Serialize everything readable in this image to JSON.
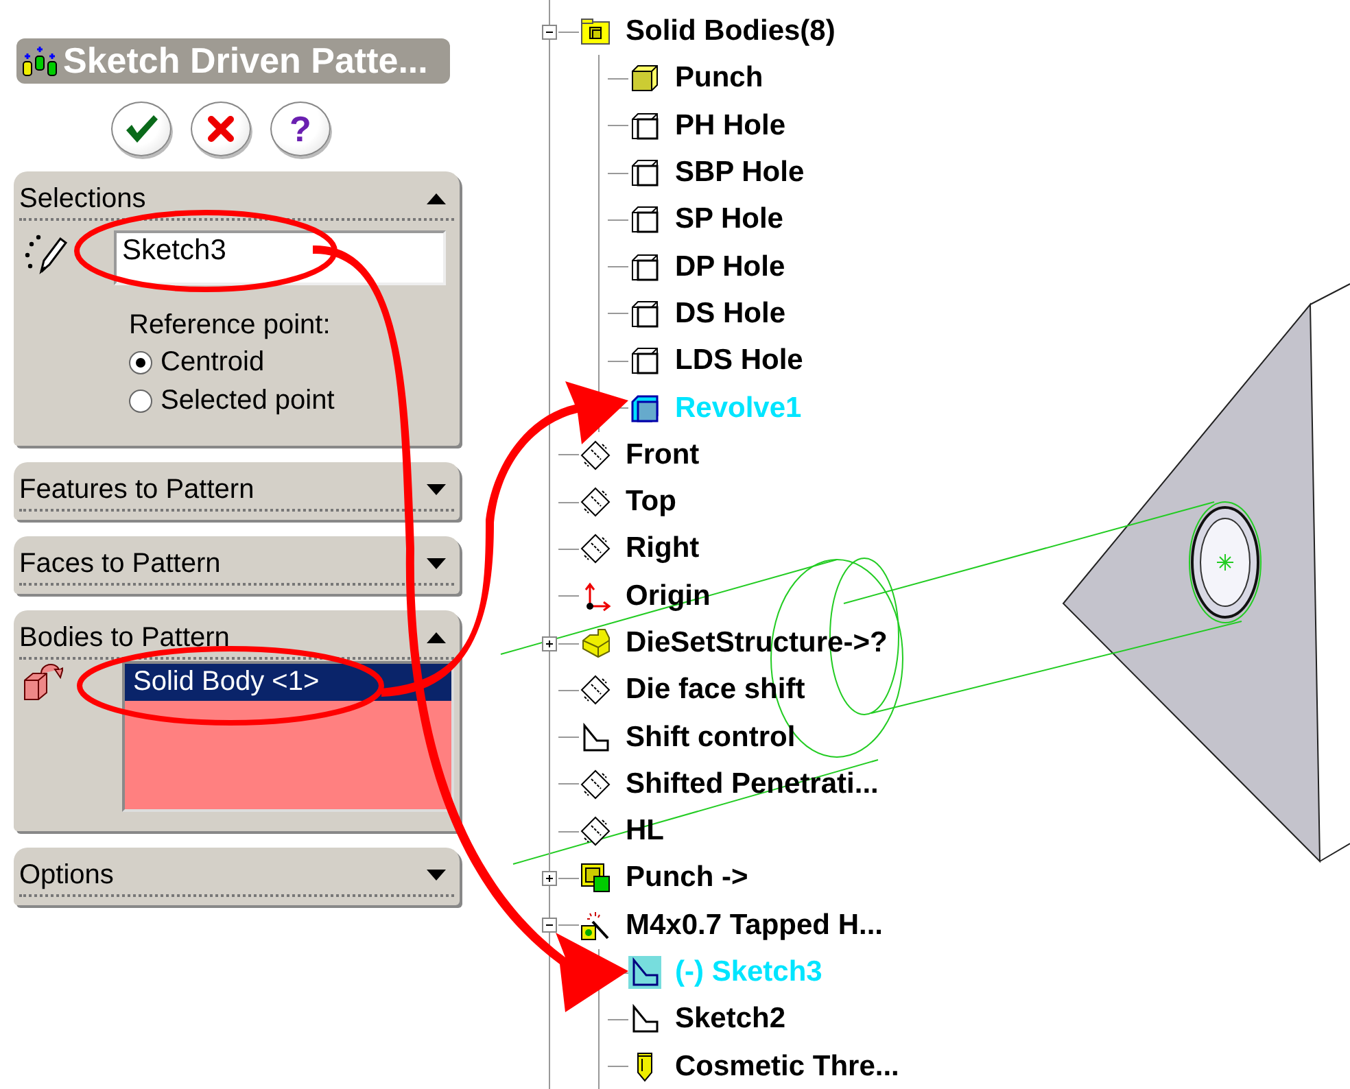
{
  "panel": {
    "title": "Sketch Driven Patte...",
    "buttons": [
      {
        "kind": "ok"
      },
      {
        "kind": "cancel"
      },
      {
        "kind": "help",
        "label": "?"
      }
    ],
    "sections": [
      {
        "kind": "selections",
        "title": "Selections",
        "expanded": true,
        "field": {
          "value": "Sketch3"
        },
        "group_label": "Reference point:",
        "options": [
          {
            "label": "Centroid",
            "selected": true
          },
          {
            "label": "Selected point",
            "selected": false
          }
        ]
      },
      {
        "kind": "plain",
        "title": "Features to Pattern",
        "expanded": false
      },
      {
        "kind": "plain",
        "title": "Faces to Pattern",
        "expanded": false
      },
      {
        "kind": "bodies",
        "title": "Bodies to Pattern",
        "expanded": true,
        "list": [
          {
            "label": "Solid Body <1>",
            "selected": true
          }
        ]
      },
      {
        "kind": "plain",
        "title": "Options",
        "expanded": false
      }
    ]
  },
  "tree": [
    {
      "label": "Solid Bodies(8)",
      "kind": "folder",
      "selected": false,
      "expanded": true,
      "children": [
        {
          "label": "Punch",
          "kind": "solid",
          "selected": false
        },
        {
          "label": "PH Hole",
          "kind": "body",
          "selected": false
        },
        {
          "label": "SBP Hole",
          "kind": "body",
          "selected": false
        },
        {
          "label": "SP Hole",
          "kind": "body",
          "selected": false
        },
        {
          "label": "DP Hole",
          "kind": "body",
          "selected": false
        },
        {
          "label": "DS Hole",
          "kind": "body",
          "selected": false
        },
        {
          "label": "LDS Hole",
          "kind": "body",
          "selected": false
        },
        {
          "label": "Revolve1",
          "kind": "body",
          "selected": true
        }
      ]
    },
    {
      "label": "Front",
      "kind": "plane",
      "selected": false
    },
    {
      "label": "Top",
      "kind": "plane",
      "selected": false
    },
    {
      "label": "Right",
      "kind": "plane",
      "selected": false
    },
    {
      "label": "Origin",
      "kind": "origin",
      "selected": false
    },
    {
      "label": "DieSetStructure->?",
      "kind": "part",
      "selected": false,
      "expanded": false
    },
    {
      "label": "Die face shift",
      "kind": "plane",
      "selected": false
    },
    {
      "label": "Shift control",
      "kind": "sketch",
      "selected": false
    },
    {
      "label": "Shifted Penetrati...",
      "kind": "plane",
      "selected": false
    },
    {
      "label": "HL",
      "kind": "plane",
      "selected": false
    },
    {
      "label": "Punch ->",
      "kind": "component",
      "selected": false,
      "expanded": false
    },
    {
      "label": "M4x0.7 Tapped H...",
      "kind": "hole",
      "selected": false,
      "expanded": true,
      "children": [
        {
          "label": "(-) Sketch3",
          "kind": "sketch",
          "selected": true
        },
        {
          "label": "Sketch2",
          "kind": "sketch",
          "selected": false
        },
        {
          "label": "Cosmetic Thre...",
          "kind": "thread",
          "selected": false
        }
      ]
    }
  ]
}
